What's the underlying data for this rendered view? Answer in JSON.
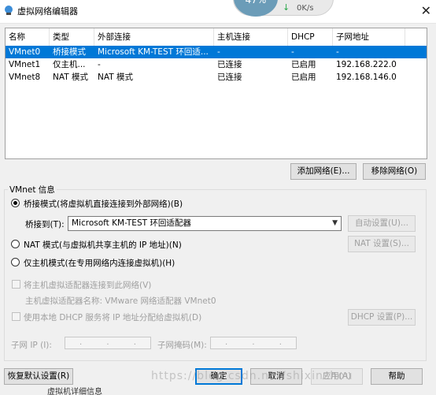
{
  "window": {
    "title": "虚拟网络编辑器",
    "close_glyph": "✕"
  },
  "overlay": {
    "percent": "47%",
    "speed": "0K/s",
    "arrow_glyph": "↓"
  },
  "table": {
    "columns": [
      "名称",
      "类型",
      "外部连接",
      "主机连接",
      "DHCP",
      "子网地址"
    ],
    "rows": [
      [
        "VMnet0",
        "桥接模式",
        "Microsoft KM-TEST 环回适...",
        "-",
        "-",
        "-"
      ],
      [
        "VMnet1",
        "仅主机...",
        "-",
        "已连接",
        "已启用",
        "192.168.222.0"
      ],
      [
        "VMnet8",
        "NAT 模式",
        "NAT 模式",
        "已连接",
        "已启用",
        "192.168.146.0"
      ]
    ],
    "selected_row": 0
  },
  "table_buttons": {
    "add": "添加网络(E)...",
    "remove": "移除网络(O)"
  },
  "vmnet_info": {
    "label": "VMnet 信息",
    "bridged": {
      "label": "桥接模式(将虚拟机直接连接到外部网络)(B)",
      "checked": true
    },
    "bridged_to_label": "桥接到(T):",
    "bridged_to_value": "Microsoft KM-TEST 环回适配器",
    "auto_settings": "自动设置(U)...",
    "nat": {
      "label": "NAT 模式(与虚拟机共享主机的 IP 地址)(N)",
      "checked": false
    },
    "nat_settings": "NAT 设置(S)...",
    "host_only": {
      "label": "仅主机模式(在专用网络内连接虚拟机)(H)",
      "checked": false
    },
    "connect_adapter": "将主机虚拟适配器连接到此网络(V)",
    "adapter_name": "主机虚拟适配器名称: VMware 网络适配器 VMnet0",
    "use_dhcp": "使用本地 DHCP 服务将 IP 地址分配给虚拟机(D)",
    "dhcp_settings": "DHCP 设置(P)...",
    "subnet_ip_label": "子网 IP (I):",
    "subnet_mask_label": "子网掩码(M):",
    "ip_placeholder": ". . ."
  },
  "footer": {
    "restore": "恢复默认设置(R)",
    "ok": "确定",
    "cancel": "取消",
    "apply": "应用(A)",
    "help": "帮助"
  },
  "watermark": "https://blog.csdn.net/shixinzhou",
  "behind_text": "虚拟机详细信息"
}
